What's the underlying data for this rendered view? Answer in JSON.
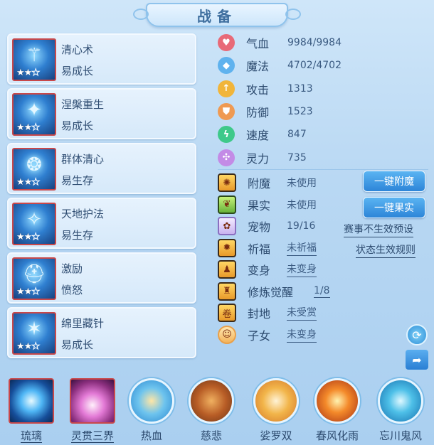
{
  "window": {
    "title": "战备"
  },
  "skills": [
    {
      "name": "清心术",
      "type": "易成长",
      "stars": 2,
      "max_stars": 3,
      "icon": "staff-icon"
    },
    {
      "name": "涅槃重生",
      "type": "易成长",
      "stars": 2,
      "max_stars": 3,
      "icon": "phoenix-icon"
    },
    {
      "name": "群体清心",
      "type": "易生存",
      "stars": 2,
      "max_stars": 3,
      "icon": "aura-icon"
    },
    {
      "name": "天地护法",
      "type": "易生存",
      "stars": 2,
      "max_stars": 3,
      "icon": "guardian-icon"
    },
    {
      "name": "激励",
      "type": "愤怒",
      "stars": 2,
      "max_stars": 3,
      "icon": "helmet-icon"
    },
    {
      "name": "绵里藏针",
      "type": "易成长",
      "stars": 2,
      "max_stars": 3,
      "icon": "needle-icon"
    }
  ],
  "stats": [
    {
      "label": "气血",
      "value": "9984/9984",
      "color": "#e86a78",
      "icon": "heart-icon"
    },
    {
      "label": "魔法",
      "value": "4702/4702",
      "color": "#5fb2ee",
      "icon": "mana-icon"
    },
    {
      "label": "攻击",
      "value": "1313",
      "color": "#f1b53a",
      "icon": "sword-icon"
    },
    {
      "label": "防御",
      "value": "1523",
      "color": "#ef9a52",
      "icon": "shield-icon"
    },
    {
      "label": "速度",
      "value": "847",
      "color": "#3ec98a",
      "icon": "lightning-icon"
    },
    {
      "label": "灵力",
      "value": "735",
      "color": "#c38be6",
      "icon": "spirit-icon"
    }
  ],
  "attrs": [
    {
      "label": "附魔",
      "value": "未使用",
      "underline": false,
      "icon": "enchant-icon"
    },
    {
      "label": "果实",
      "value": "未使用",
      "underline": false,
      "icon": "fruit-icon"
    },
    {
      "label": "宠物",
      "value": "19/16",
      "underline": false,
      "icon": "pet-icon"
    },
    {
      "label": "祈福",
      "value": "未祈福",
      "underline": true,
      "icon": "pray-icon"
    },
    {
      "label": "变身",
      "value": "未变身",
      "underline": true,
      "icon": "transform-icon"
    },
    {
      "label": "修炼觉醒",
      "value": "1/8",
      "underline": true,
      "icon": "cultivate-icon"
    },
    {
      "label": "封地",
      "value": "未受赏",
      "underline": true,
      "icon": "fief-icon"
    },
    {
      "label": "子女",
      "value": "未变身",
      "underline": true,
      "icon": "child-icon"
    }
  ],
  "buttons": {
    "one_click_enchant": "一键附魔",
    "one_click_fruit": "一键果实"
  },
  "links": {
    "tournament_preset": "赛事不生效预设",
    "status_rules": "状态生效规则"
  },
  "side_icons": [
    "refresh-icon",
    "share-icon"
  ],
  "bottom_bar": [
    {
      "label": "琉璃",
      "style": "square",
      "underline": true,
      "icon": "orb-icon"
    },
    {
      "label": "灵贯三界",
      "style": "square",
      "underline": true,
      "icon": "pagoda-icon"
    },
    {
      "label": "热血",
      "style": "round",
      "underline": false,
      "icon": "figure-icon"
    },
    {
      "label": "慈悲",
      "style": "round",
      "underline": false,
      "icon": "bridge-icon"
    },
    {
      "label": "娑罗双",
      "style": "round",
      "underline": false,
      "icon": "hand-icon"
    },
    {
      "label": "春风化雨",
      "style": "round",
      "underline": false,
      "icon": "burst-icon"
    },
    {
      "label": "忘川鬼风",
      "style": "round",
      "underline": false,
      "icon": "wind-icon"
    }
  ]
}
